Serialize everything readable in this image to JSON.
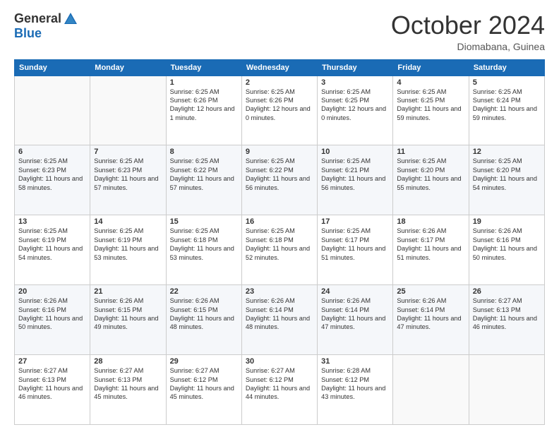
{
  "header": {
    "logo_general": "General",
    "logo_blue": "Blue",
    "month": "October 2024",
    "location": "Diomabana, Guinea"
  },
  "weekdays": [
    "Sunday",
    "Monday",
    "Tuesday",
    "Wednesday",
    "Thursday",
    "Friday",
    "Saturday"
  ],
  "weeks": [
    [
      {
        "day": "",
        "text": ""
      },
      {
        "day": "",
        "text": ""
      },
      {
        "day": "1",
        "text": "Sunrise: 6:25 AM\nSunset: 6:26 PM\nDaylight: 12 hours and 1 minute."
      },
      {
        "day": "2",
        "text": "Sunrise: 6:25 AM\nSunset: 6:26 PM\nDaylight: 12 hours and 0 minutes."
      },
      {
        "day": "3",
        "text": "Sunrise: 6:25 AM\nSunset: 6:25 PM\nDaylight: 12 hours and 0 minutes."
      },
      {
        "day": "4",
        "text": "Sunrise: 6:25 AM\nSunset: 6:25 PM\nDaylight: 11 hours and 59 minutes."
      },
      {
        "day": "5",
        "text": "Sunrise: 6:25 AM\nSunset: 6:24 PM\nDaylight: 11 hours and 59 minutes."
      }
    ],
    [
      {
        "day": "6",
        "text": "Sunrise: 6:25 AM\nSunset: 6:23 PM\nDaylight: 11 hours and 58 minutes."
      },
      {
        "day": "7",
        "text": "Sunrise: 6:25 AM\nSunset: 6:23 PM\nDaylight: 11 hours and 57 minutes."
      },
      {
        "day": "8",
        "text": "Sunrise: 6:25 AM\nSunset: 6:22 PM\nDaylight: 11 hours and 57 minutes."
      },
      {
        "day": "9",
        "text": "Sunrise: 6:25 AM\nSunset: 6:22 PM\nDaylight: 11 hours and 56 minutes."
      },
      {
        "day": "10",
        "text": "Sunrise: 6:25 AM\nSunset: 6:21 PM\nDaylight: 11 hours and 56 minutes."
      },
      {
        "day": "11",
        "text": "Sunrise: 6:25 AM\nSunset: 6:20 PM\nDaylight: 11 hours and 55 minutes."
      },
      {
        "day": "12",
        "text": "Sunrise: 6:25 AM\nSunset: 6:20 PM\nDaylight: 11 hours and 54 minutes."
      }
    ],
    [
      {
        "day": "13",
        "text": "Sunrise: 6:25 AM\nSunset: 6:19 PM\nDaylight: 11 hours and 54 minutes."
      },
      {
        "day": "14",
        "text": "Sunrise: 6:25 AM\nSunset: 6:19 PM\nDaylight: 11 hours and 53 minutes."
      },
      {
        "day": "15",
        "text": "Sunrise: 6:25 AM\nSunset: 6:18 PM\nDaylight: 11 hours and 53 minutes."
      },
      {
        "day": "16",
        "text": "Sunrise: 6:25 AM\nSunset: 6:18 PM\nDaylight: 11 hours and 52 minutes."
      },
      {
        "day": "17",
        "text": "Sunrise: 6:25 AM\nSunset: 6:17 PM\nDaylight: 11 hours and 51 minutes."
      },
      {
        "day": "18",
        "text": "Sunrise: 6:26 AM\nSunset: 6:17 PM\nDaylight: 11 hours and 51 minutes."
      },
      {
        "day": "19",
        "text": "Sunrise: 6:26 AM\nSunset: 6:16 PM\nDaylight: 11 hours and 50 minutes."
      }
    ],
    [
      {
        "day": "20",
        "text": "Sunrise: 6:26 AM\nSunset: 6:16 PM\nDaylight: 11 hours and 50 minutes."
      },
      {
        "day": "21",
        "text": "Sunrise: 6:26 AM\nSunset: 6:15 PM\nDaylight: 11 hours and 49 minutes."
      },
      {
        "day": "22",
        "text": "Sunrise: 6:26 AM\nSunset: 6:15 PM\nDaylight: 11 hours and 48 minutes."
      },
      {
        "day": "23",
        "text": "Sunrise: 6:26 AM\nSunset: 6:14 PM\nDaylight: 11 hours and 48 minutes."
      },
      {
        "day": "24",
        "text": "Sunrise: 6:26 AM\nSunset: 6:14 PM\nDaylight: 11 hours and 47 minutes."
      },
      {
        "day": "25",
        "text": "Sunrise: 6:26 AM\nSunset: 6:14 PM\nDaylight: 11 hours and 47 minutes."
      },
      {
        "day": "26",
        "text": "Sunrise: 6:27 AM\nSunset: 6:13 PM\nDaylight: 11 hours and 46 minutes."
      }
    ],
    [
      {
        "day": "27",
        "text": "Sunrise: 6:27 AM\nSunset: 6:13 PM\nDaylight: 11 hours and 46 minutes."
      },
      {
        "day": "28",
        "text": "Sunrise: 6:27 AM\nSunset: 6:13 PM\nDaylight: 11 hours and 45 minutes."
      },
      {
        "day": "29",
        "text": "Sunrise: 6:27 AM\nSunset: 6:12 PM\nDaylight: 11 hours and 45 minutes."
      },
      {
        "day": "30",
        "text": "Sunrise: 6:27 AM\nSunset: 6:12 PM\nDaylight: 11 hours and 44 minutes."
      },
      {
        "day": "31",
        "text": "Sunrise: 6:28 AM\nSunset: 6:12 PM\nDaylight: 11 hours and 43 minutes."
      },
      {
        "day": "",
        "text": ""
      },
      {
        "day": "",
        "text": ""
      }
    ]
  ]
}
